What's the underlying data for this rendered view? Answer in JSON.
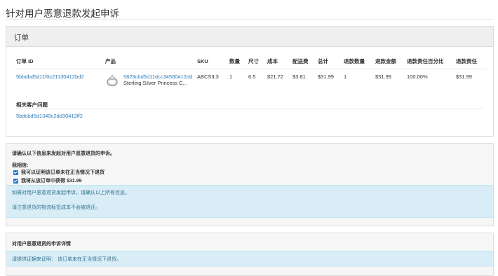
{
  "page": {
    "title": "针对用户恶意退款发起申诉"
  },
  "order_panel": {
    "title": "订单",
    "columns": [
      "订单 ID",
      "产品",
      "SKU",
      "数量",
      "尺寸",
      "成本",
      "配送费",
      "总计",
      "退款数量",
      "退款金额",
      "退款责任百分比",
      "退款责任"
    ],
    "row": {
      "order_id": "5bbdbd5d11f0c21130412bd2",
      "product_id": "5823cbd5d11dcc34560412dd",
      "product_name": "Sterling Silver Princess C...",
      "sku": "ABCSIL3",
      "quantity": "1",
      "size": "6.5",
      "cost": "$21.72",
      "shipping": "$3.81",
      "total": "$31.99",
      "refund_quantity": "1",
      "refund_amount": "$31.99",
      "refund_responsibility_pct": "100.00%",
      "refund_responsibility": "$31.99"
    },
    "related_label": "相关客户问题",
    "related_link": "5bdcbd5d1340c2dd30412ff2"
  },
  "confirm_panel": {
    "prompt": "请确认以下信息来发起对用户恶意退货的申诉。",
    "believe_label": "我相信:",
    "checkbox1": "我可以证明该订单未在正当情况下退货",
    "checkbox2": "我将从该订单中获得 $31.99",
    "info_line1": "如需对用户恶意退货发起申诉，请确认以上所有信息。",
    "info_line2": "请注意退货的物流标签成本不会被退还。"
  },
  "detail_panel": {
    "title": "对用户恶意退货的申诉详情",
    "info": "请提供证据来证明： 该订单未在正当情况下退货。"
  },
  "colors": {
    "link": "#2a7ab8",
    "info_bg": "#d9edf7",
    "info_text": "#31708f",
    "checkbox": "#2a74d6"
  }
}
